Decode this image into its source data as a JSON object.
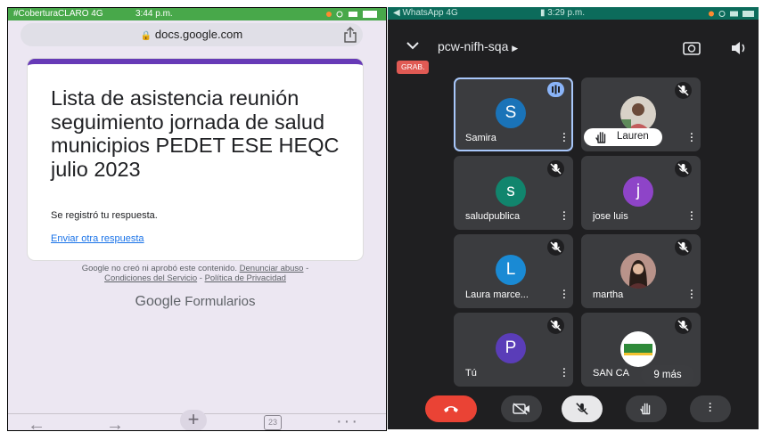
{
  "left_phone": {
    "status_bar": {
      "carrier": "#CoberturaCLARO  4G",
      "time": "3:44 p.m."
    },
    "address_bar": {
      "url": "docs.google.com"
    },
    "form": {
      "title": "Lista de asistencia reunión seguimiento jornada de salud municipios PEDET ESE HEQC julio 2023",
      "confirmation": "Se registró tu respuesta.",
      "another_response_link": "Enviar otra respuesta"
    },
    "footer": {
      "disclaimer": "Google no creó ni aprobó este contenido.",
      "report_link": "Denunciar abuso",
      "separator": "-",
      "terms_link": "Condiciones del Servicio",
      "separator2": "-",
      "privacy_link": "Política de Privacidad",
      "brand_google": "Google",
      "brand_product": "Formularios"
    },
    "bottom_bar": {
      "tab_count": "23"
    }
  },
  "right_phone": {
    "status_bar": {
      "left": "WhatsApp   4G",
      "time": "3:29 p.m."
    },
    "meeting_code": "pcw-nifh-sqa",
    "recording_badge": "GRAB.",
    "participants": [
      {
        "name": "Samira",
        "initial": "S",
        "color": "#1a73b8",
        "speaking": true
      },
      {
        "name": "Lauren",
        "initial": "",
        "color": "",
        "hand_raised": true,
        "photo": true
      },
      {
        "name": "saludpublica",
        "initial": "s",
        "color": "#11856d"
      },
      {
        "name": "jose luis",
        "initial": "j",
        "color": "#8e44c8"
      },
      {
        "name": "Laura marce...",
        "initial": "L",
        "color": "#1a8ad4"
      },
      {
        "name": "martha",
        "initial": "",
        "color": "",
        "photo": true
      },
      {
        "name": "Tú",
        "initial": "P",
        "color": "#5a3db8"
      },
      {
        "name": "SAN CA",
        "initial": "",
        "color": "",
        "logo": true
      }
    ],
    "more_participants": "9 más",
    "colors": {
      "end_call": "#ea4335",
      "speaking": "#8ab4f8"
    }
  }
}
